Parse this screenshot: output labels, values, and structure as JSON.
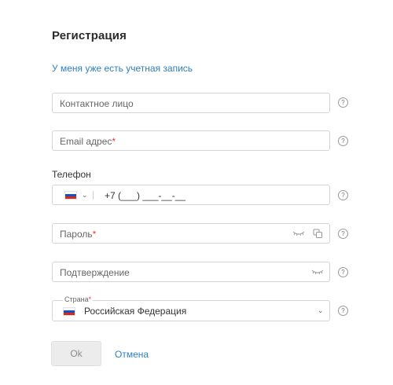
{
  "form": {
    "title": "Регистрация",
    "login_link": "У меня уже есть учетная запись",
    "contact_placeholder": "Контактное лицо",
    "email_placeholder": "Email адрес",
    "required_mark": "*",
    "phone_label": "Телефон",
    "phone_mask": "+7 (___) ___-__-__",
    "password_placeholder": "Пароль",
    "confirm_placeholder": "Подтверждение",
    "country_label": "Страна",
    "country_value": "Российская Федерация",
    "help_glyph": "?",
    "ok_label": "Ok",
    "cancel_label": "Отмена"
  },
  "icons": {
    "help": "question-circle-icon",
    "flag": "russia-flag-icon",
    "chevron": "chevron-down-icon",
    "password_eye": "eye-closed-icon",
    "generate": "copy-icon"
  },
  "colors": {
    "link": "#2f7fc1",
    "required": "#e33b3b",
    "button_bg": "#ececec",
    "border": "#d4d4d4"
  }
}
